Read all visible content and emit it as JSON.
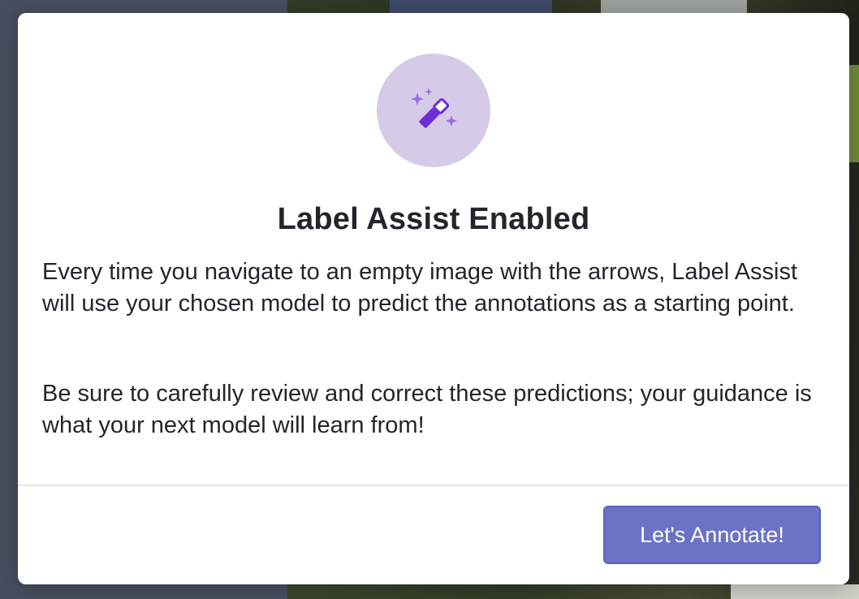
{
  "modal": {
    "icon": "magic-wand-icon",
    "title": "Label Assist Enabled",
    "paragraphs": [
      "Every time you navigate to an empty image with the arrows, Label Assist will use your chosen model to predict the annotations as a starting point.",
      "Be sure to carefully review and correct these predictions; your guidance is what your next model will learn from!"
    ],
    "primary_button_label": "Let's Annotate!"
  },
  "colors": {
    "accent": "#6b73c6",
    "icon_circle_bg": "#d5cbe9",
    "icon_fg": "#6a2fd6",
    "text": "#22262c"
  }
}
